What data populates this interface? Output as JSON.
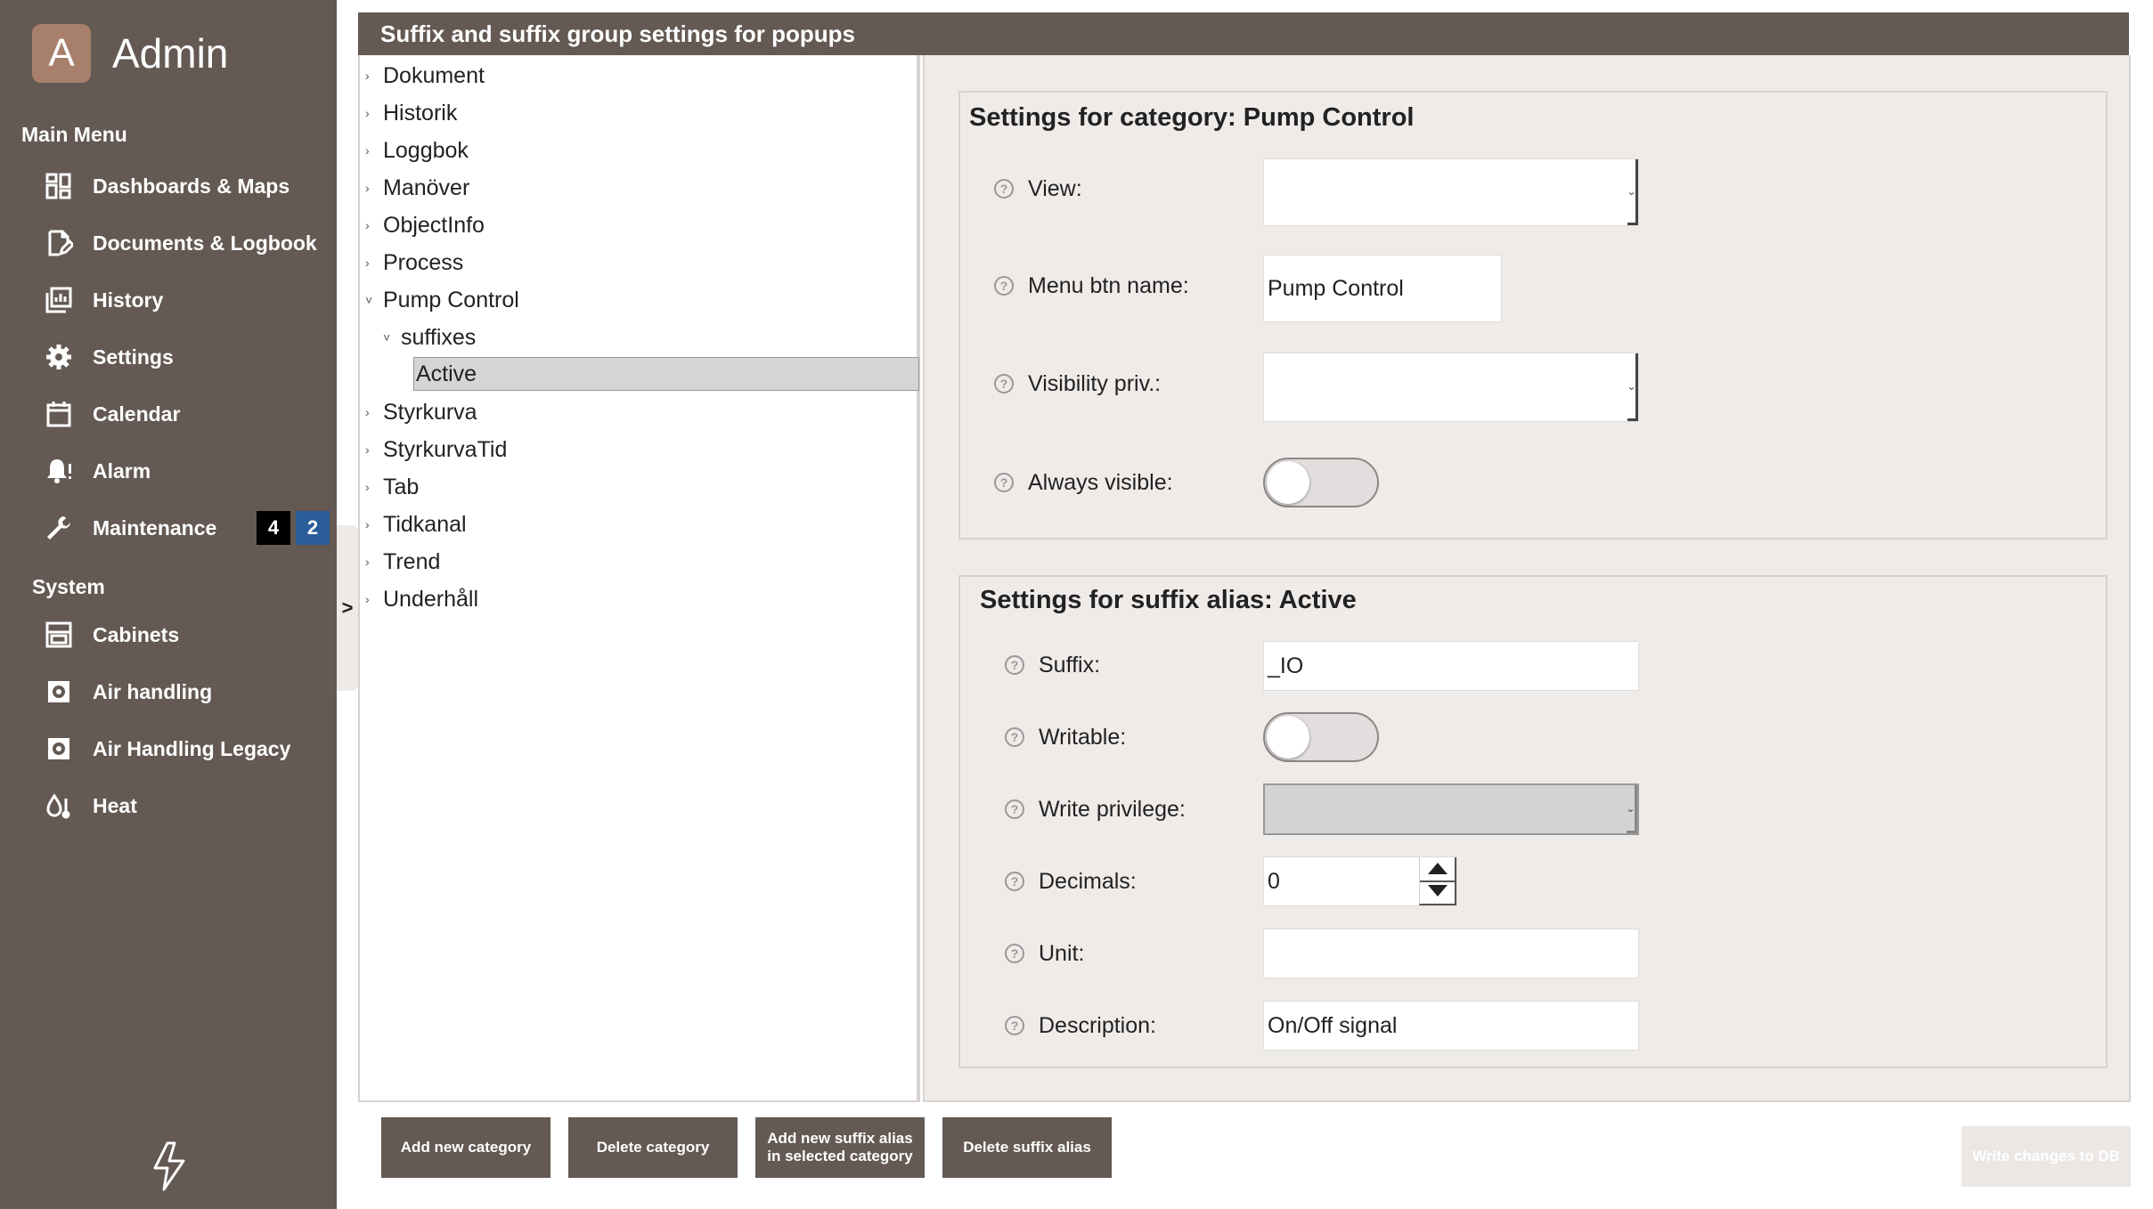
{
  "app": {
    "logo_letter": "A",
    "title": "Admin"
  },
  "sidebar": {
    "main_menu_label": "Main Menu",
    "main_items": [
      {
        "label": "Dashboards & Maps",
        "icon": "dashboard-icon"
      },
      {
        "label": "Documents & Logbook",
        "icon": "document-edit-icon"
      },
      {
        "label": "History",
        "icon": "history-chart-icon"
      },
      {
        "label": "Settings",
        "icon": "gear-icon"
      },
      {
        "label": "Calendar",
        "icon": "calendar-icon"
      },
      {
        "label": "Alarm",
        "icon": "bell-alert-icon"
      },
      {
        "label": "Maintenance",
        "icon": "wrench-icon",
        "badge_black": "4",
        "badge_blue": "2"
      }
    ],
    "system_label": "System",
    "system_items": [
      {
        "label": "Cabinets",
        "icon": "cabinet-icon"
      },
      {
        "label": "Air handling",
        "icon": "air-handling-icon"
      },
      {
        "label": "Air Handling Legacy",
        "icon": "air-handling-icon"
      },
      {
        "label": "Heat",
        "icon": "heat-drop-icon"
      }
    ],
    "collapse_label": ">"
  },
  "panel": {
    "title": "Suffix and suffix group settings for popups"
  },
  "tree": {
    "items": [
      {
        "label": "Dokument",
        "chev": "›"
      },
      {
        "label": "Historik",
        "chev": "›"
      },
      {
        "label": "Loggbok",
        "chev": "›"
      },
      {
        "label": "Manöver",
        "chev": "›"
      },
      {
        "label": "ObjectInfo",
        "chev": "›"
      },
      {
        "label": "Process",
        "chev": "›"
      },
      {
        "label": "Pump Control",
        "chev": "˅"
      },
      {
        "label": "suffixes",
        "chev": "˅"
      },
      {
        "label": "Active",
        "chev": ""
      },
      {
        "label": "Styrkurva",
        "chev": "›"
      },
      {
        "label": "StyrkurvaTid",
        "chev": "›"
      },
      {
        "label": "Tab",
        "chev": "›"
      },
      {
        "label": "Tidkanal",
        "chev": "›"
      },
      {
        "label": "Trend",
        "chev": "›"
      },
      {
        "label": "Underhåll",
        "chev": "›"
      }
    ]
  },
  "category_settings": {
    "title": "Settings for category: Pump Control",
    "view_label": "View:",
    "view_value": "",
    "menu_btn_label": "Menu btn name:",
    "menu_btn_value": "Pump Control",
    "visibility_label": "Visibility priv.:",
    "visibility_value": "",
    "always_visible_label": "Always visible:",
    "always_visible_on": false
  },
  "suffix_settings": {
    "title": "Settings for suffix alias: Active",
    "suffix_label": "Suffix:",
    "suffix_value": "_IO",
    "writable_label": "Writable:",
    "writable_on": false,
    "write_priv_label": "Write privilege:",
    "write_priv_value": "",
    "decimals_label": "Decimals:",
    "decimals_value": "0",
    "unit_label": "Unit:",
    "unit_value": "",
    "description_label": "Description:",
    "description_value": "On/Off signal"
  },
  "buttons": {
    "add_category": "Add new category",
    "delete_category": "Delete category",
    "add_suffix_line1": "Add new suffix alias",
    "add_suffix_line2": "in selected category",
    "delete_suffix": "Delete suffix alias",
    "write_db": "Write changes to DB"
  },
  "colors": {
    "sidebar_bg": "#645953",
    "logo_bg": "#a87f6b",
    "badge_blue": "#2a5d99",
    "panel_bg": "#efebe9",
    "selected_row": "#d6d4d6"
  }
}
